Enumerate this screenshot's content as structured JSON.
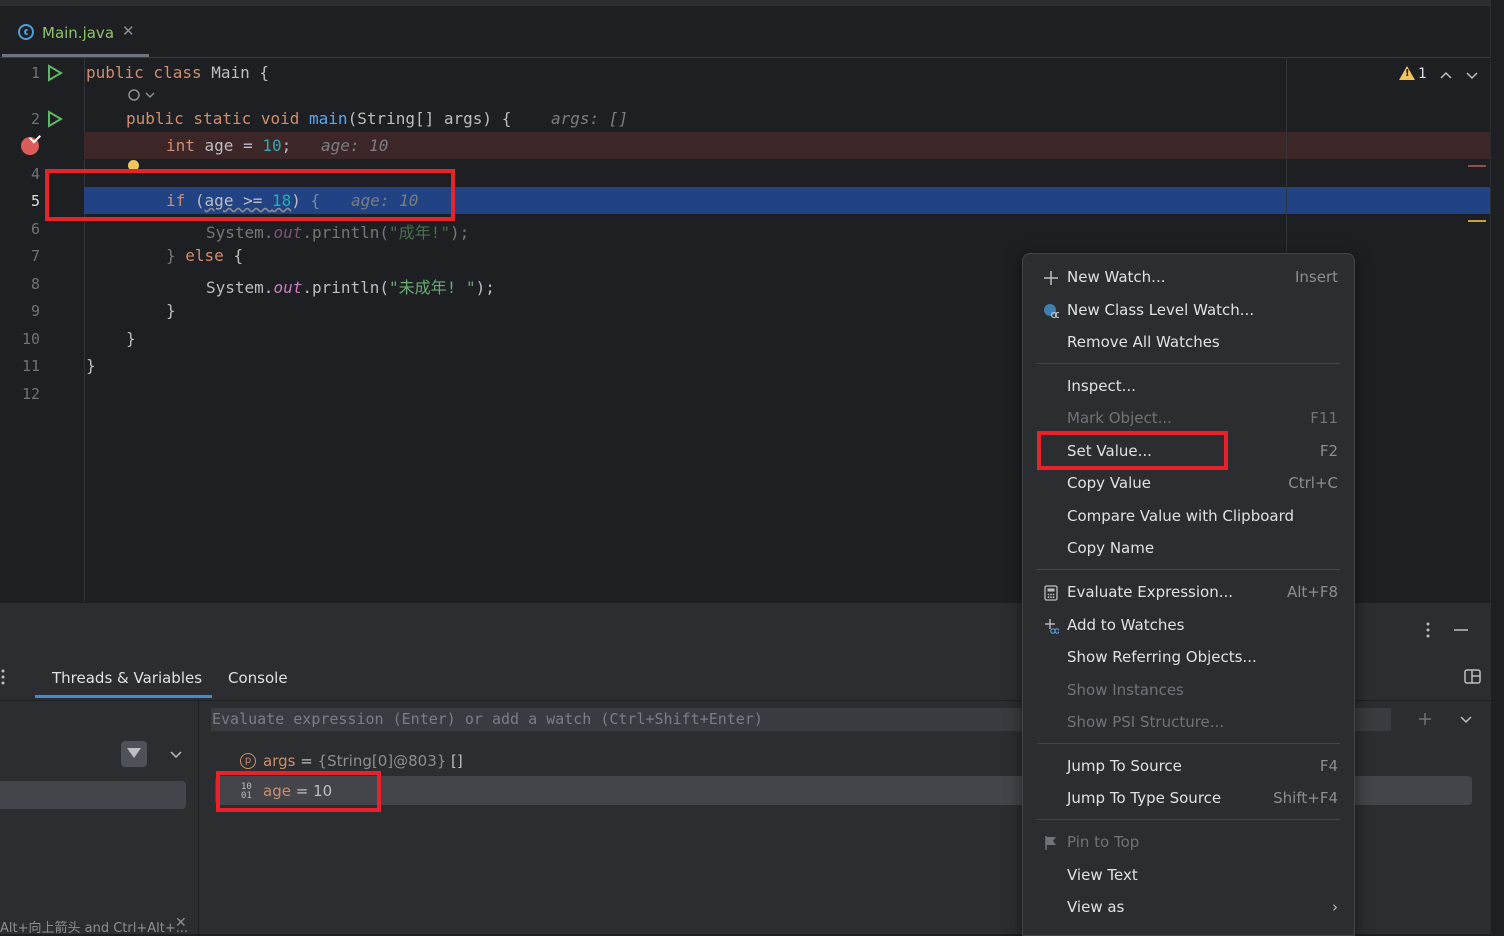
{
  "editor_tab": {
    "filename": "Main.java",
    "close": "✕"
  },
  "warnings": {
    "count": "1"
  },
  "code_lines": [
    {
      "num": "1",
      "text": "public class Main {"
    },
    {
      "num": "2",
      "text": "public static void main(String[] args) {",
      "hint": "args: []"
    },
    {
      "num": "3",
      "text": "int age = 10;",
      "hint": "age: 10"
    },
    {
      "num": "4",
      "text": ""
    },
    {
      "num": "5",
      "text": "if (age >= 18) {",
      "hint": "age: 10"
    },
    {
      "num": "6",
      "text": "System.out.println(\"成年!\");"
    },
    {
      "num": "7",
      "text": "} else {"
    },
    {
      "num": "8",
      "text": "System.out.println(\"未成年! \");"
    },
    {
      "num": "9",
      "text": "}"
    },
    {
      "num": "10",
      "text": "}"
    },
    {
      "num": "11",
      "text": "}"
    },
    {
      "num": "12",
      "text": ""
    }
  ],
  "debug_panel": {
    "tabs": [
      "Threads & Variables",
      "Console"
    ],
    "eval_placeholder": "Evaluate expression (Enter) or add a watch (Ctrl+Shift+Enter)",
    "variables": [
      {
        "name": "args",
        "eq": " = ",
        "value": "{String[0]@803}",
        "extra": " []"
      },
      {
        "name": "age",
        "eq": " = ",
        "value": "10"
      }
    ],
    "status_hint": "Alt+向上箭头 and Ctrl+Alt+..."
  },
  "context_menu": {
    "items": [
      {
        "label": "New Watch...",
        "shortcut": "Insert",
        "icon": "plus-icon"
      },
      {
        "label": "New Class Level Watch...",
        "shortcut": "",
        "icon": "class-watch-icon"
      },
      {
        "label": "Remove All Watches",
        "shortcut": ""
      },
      {
        "label": "Inspect...",
        "shortcut": ""
      },
      {
        "label": "Mark Object...",
        "shortcut": "F11",
        "disabled": true
      },
      {
        "label": "Set Value...",
        "shortcut": "F2"
      },
      {
        "label": "Copy Value",
        "shortcut": "Ctrl+C"
      },
      {
        "label": "Compare Value with Clipboard",
        "shortcut": ""
      },
      {
        "label": "Copy Name",
        "shortcut": ""
      },
      {
        "label": "Evaluate Expression...",
        "shortcut": "Alt+F8",
        "icon": "calculator-icon"
      },
      {
        "label": "Add to Watches",
        "shortcut": "",
        "icon": "add-watch-icon"
      },
      {
        "label": "Show Referring Objects...",
        "shortcut": ""
      },
      {
        "label": "Show Instances",
        "shortcut": "",
        "disabled": true
      },
      {
        "label": "Show PSI Structure...",
        "shortcut": "",
        "disabled": true
      },
      {
        "label": "Jump To Source",
        "shortcut": "F4"
      },
      {
        "label": "Jump To Type Source",
        "shortcut": "Shift+F4"
      },
      {
        "label": "Pin to Top",
        "shortcut": "",
        "disabled": true,
        "icon": "pin-icon"
      },
      {
        "label": "View Text",
        "shortcut": ""
      },
      {
        "label": "View as",
        "shortcut": "›"
      }
    ]
  },
  "colors": {
    "highlight_box": "#e8222a",
    "current_line": "#214283",
    "breakpoint_line": "#3d2628"
  }
}
